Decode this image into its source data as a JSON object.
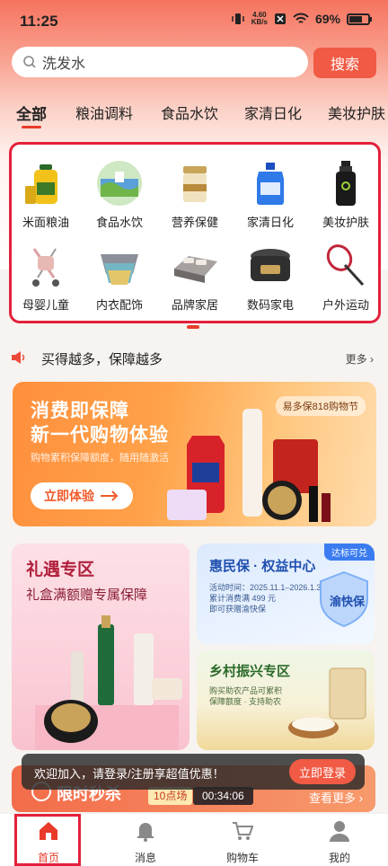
{
  "status_bar": {
    "time": "11:25",
    "net_speed": "4.60",
    "net_unit": "KB/s",
    "battery": "69%"
  },
  "search": {
    "query": "洗发水",
    "button": "搜索"
  },
  "tabs": [
    "全部",
    "粮油调料",
    "食品水饮",
    "家清日化",
    "美妆护肤"
  ],
  "categories": [
    {
      "label": "米面粮油",
      "icon": "oil-bottle-icon"
    },
    {
      "label": "食品水饮",
      "icon": "food-drink-icon"
    },
    {
      "label": "营养保健",
      "icon": "supplement-can-icon"
    },
    {
      "label": "家清日化",
      "icon": "detergent-bottle-icon"
    },
    {
      "label": "美妆护肤",
      "icon": "skincare-bottle-icon"
    },
    {
      "label": "母婴儿童",
      "icon": "stroller-icon"
    },
    {
      "label": "内衣配饰",
      "icon": "underwear-icon"
    },
    {
      "label": "品牌家居",
      "icon": "bedding-icon"
    },
    {
      "label": "数码家电",
      "icon": "rice-cooker-icon"
    },
    {
      "label": "户外运动",
      "icon": "badminton-racket-icon"
    }
  ],
  "guarantee": {
    "text": "买得越多，保障越多",
    "more": "更多"
  },
  "banner": {
    "title_line1": "消费即保障",
    "title_line2": "新一代购物体验",
    "subtitle": "购物累积保障额度，随用随激活",
    "cta": "立即体验",
    "tag": "易多保818购物节"
  },
  "card_gift": {
    "title": "礼遇专区",
    "subtitle": "礼盒满额赠专属保障"
  },
  "card_benefit": {
    "badge": "达标可兑",
    "title": "惠民保 · 权益中心",
    "line1": "活动时间：2025.11.1–2026.1.31",
    "line2": "累计消费满 499 元",
    "line3": "即可获赠渝快保",
    "stamp": "渝快保"
  },
  "card_rural": {
    "title": "乡村振兴专区",
    "line1": "购买助农产品可累积",
    "line2": "保障额度 · 支持助农"
  },
  "flash_sale": {
    "title": "限时秒杀",
    "session": "10点场",
    "timer": "00:34:06",
    "more": "查看更多"
  },
  "login_toast": {
    "text": "欢迎加入，请登录/注册享超值优惠！",
    "button": "立即登录"
  },
  "bottom_nav": [
    {
      "label": "首页",
      "icon": "home-icon"
    },
    {
      "label": "消息",
      "icon": "bell-icon"
    },
    {
      "label": "购物车",
      "icon": "cart-icon"
    },
    {
      "label": "我的",
      "icon": "user-icon"
    }
  ],
  "colors": {
    "accent": "#e83b2a",
    "search_button": "#f15a44",
    "highlight_box": "#e3203b"
  }
}
